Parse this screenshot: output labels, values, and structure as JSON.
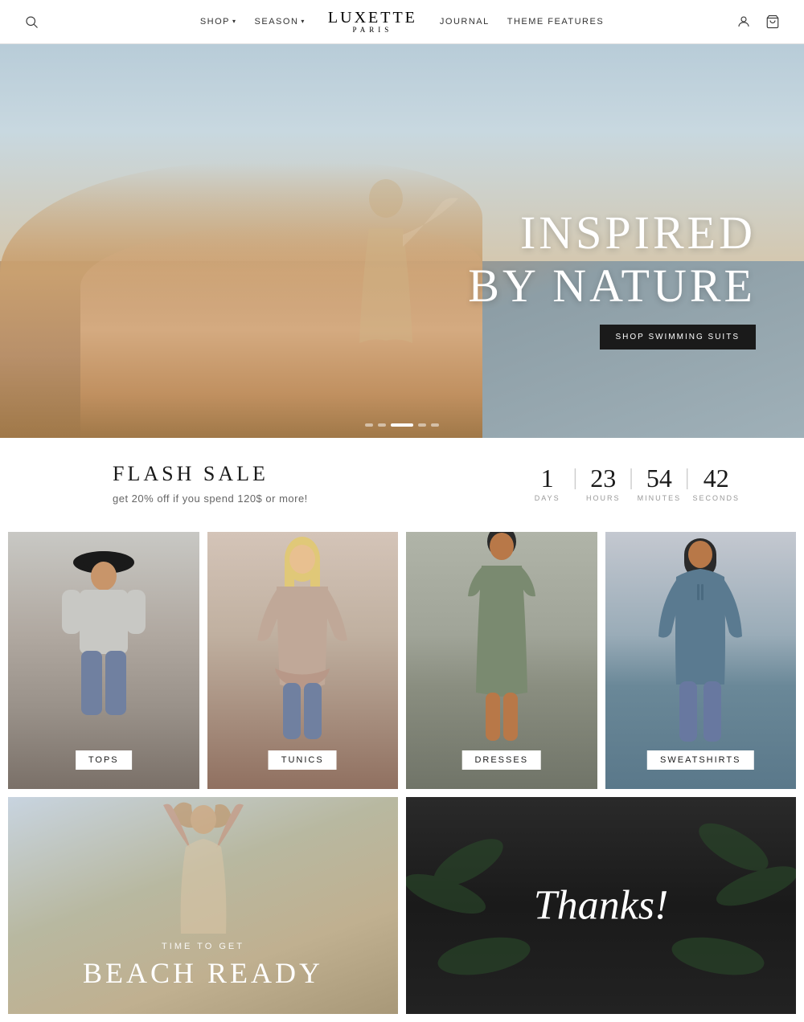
{
  "header": {
    "logo_line1": "LUXETTE",
    "logo_line2": "PARIS",
    "nav_left": [
      {
        "label": "SHOP",
        "has_dropdown": true
      },
      {
        "label": "SEASON",
        "has_dropdown": true
      }
    ],
    "nav_right": [
      {
        "label": "JOURNAL",
        "has_dropdown": false
      },
      {
        "label": "THEME FEATURES",
        "has_dropdown": false
      }
    ]
  },
  "hero": {
    "headline_line1": "INSPIRED",
    "headline_line2": "BY NATURE",
    "cta_label": "SHOP SWIMMING SUITS",
    "dots": [
      false,
      false,
      true,
      false,
      false
    ]
  },
  "flash_sale": {
    "title": "FLASH SALE",
    "subtitle": "get 20% off if you spend 120$ or more!",
    "countdown": {
      "days": "1",
      "hours": "23",
      "minutes": "54",
      "seconds": "42",
      "days_label": "DAYS",
      "hours_label": "HOURS",
      "minutes_label": "MINUTES",
      "seconds_label": "SECONDS"
    }
  },
  "categories": [
    {
      "label": "TOPS",
      "key": "tops"
    },
    {
      "label": "TUNICS",
      "key": "tunics"
    },
    {
      "label": "DRESSES",
      "key": "dresses"
    },
    {
      "label": "SWEATSHIRTS",
      "key": "sweatshirts"
    }
  ],
  "bottom_panels": [
    {
      "key": "beach",
      "sub_text": "TIME TO GET",
      "main_text": "BEACH READY"
    },
    {
      "key": "thanks",
      "thanks_text": "Thanks!"
    }
  ],
  "icons": {
    "search": "⌕",
    "account": "👤",
    "cart": "🛒"
  }
}
